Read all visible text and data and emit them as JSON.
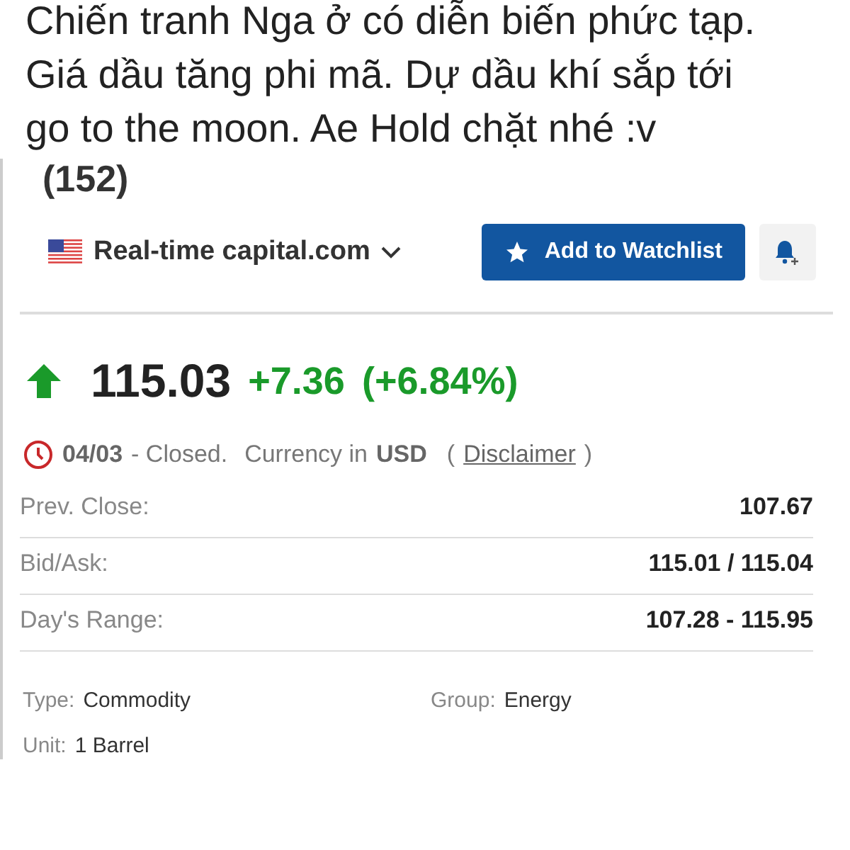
{
  "post": {
    "lines": [
      "Chiến tranh Nga ở có diễn biến phức tạp.",
      "Giá dầu tăng phi mã. Dự dầu khí sắp tới",
      "go to the moon. Ae Hold chặt nhé :v"
    ]
  },
  "quote": {
    "heading": "(152)",
    "source": "Real-time capital.com",
    "watchlist_button": "Add to Watchlist",
    "price": {
      "last": "115.03",
      "change": "+7.36",
      "change_pct": "(+6.84%)"
    },
    "status": {
      "date": "04/03",
      "state": "- Closed.",
      "currency_label": "Currency in",
      "currency": "USD",
      "open_paren": "(",
      "disclaimer": "Disclaimer",
      "close_paren": ")"
    },
    "stats": [
      {
        "label": "Prev. Close:",
        "value": "107.67"
      },
      {
        "label": "Bid/Ask:",
        "value": "115.01 / 115.04"
      },
      {
        "label": "Day's Range:",
        "value": "107.28 - 115.95"
      }
    ],
    "details": [
      {
        "label": "Type:",
        "value": "Commodity"
      },
      {
        "label": "Group:",
        "value": "Energy"
      },
      {
        "label": "Unit:",
        "value": "1 Barrel"
      }
    ]
  }
}
